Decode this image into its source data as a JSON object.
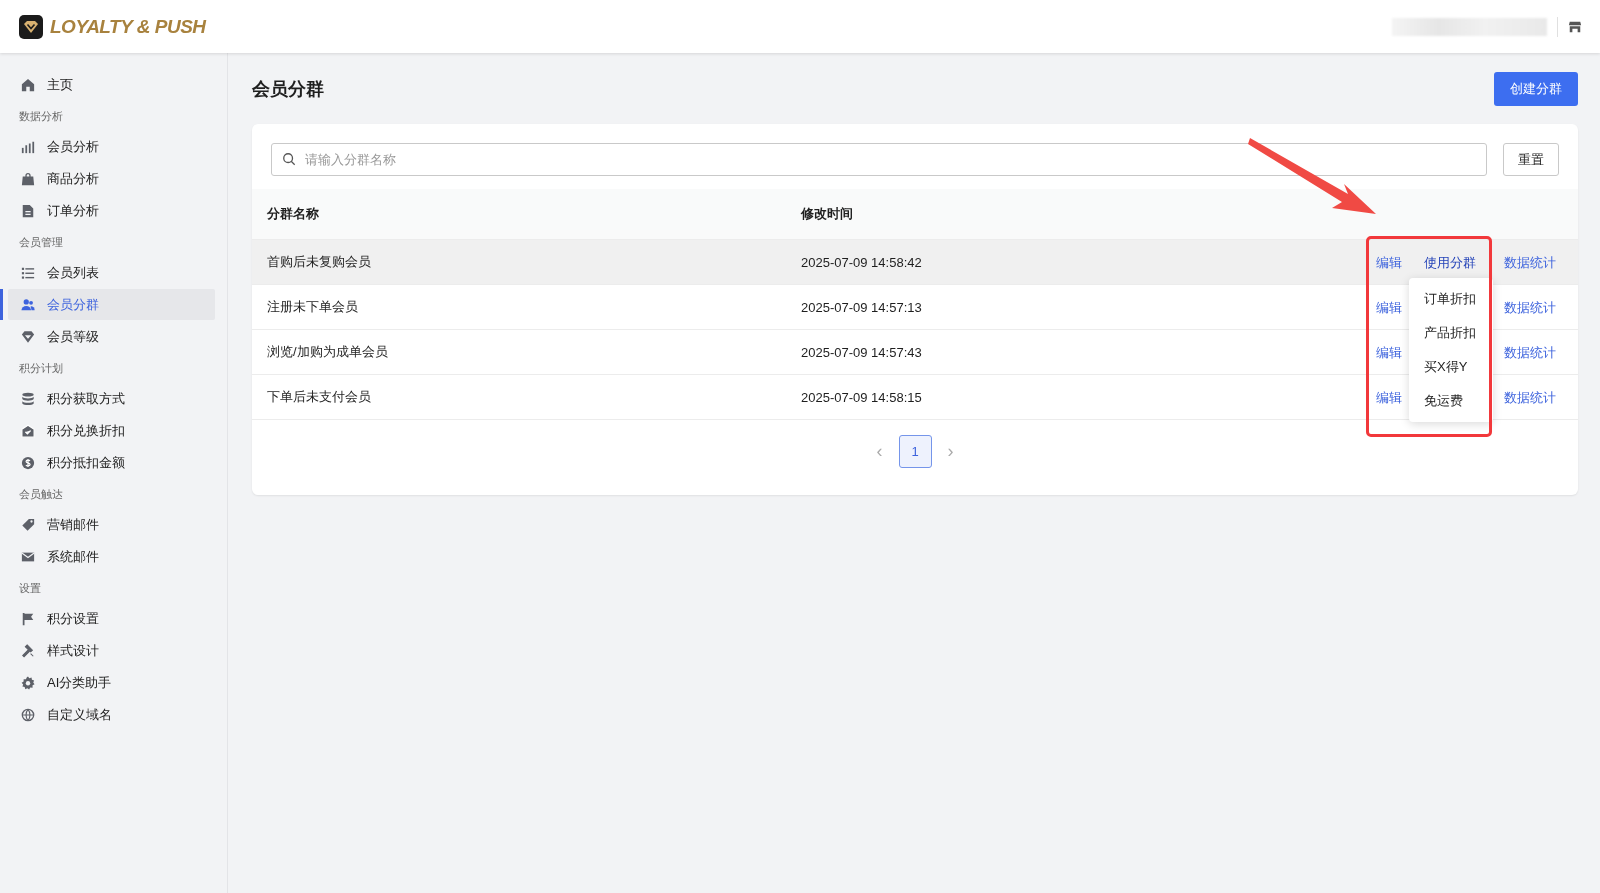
{
  "header": {
    "brand": "LOYALTY & PUSH"
  },
  "sidebar": {
    "sections": [
      {
        "items": [
          {
            "label": "主页",
            "selected": false
          }
        ]
      },
      {
        "label": "数据分析",
        "items": [
          {
            "label": "会员分析",
            "selected": false
          },
          {
            "label": "商品分析",
            "selected": false
          },
          {
            "label": "订单分析",
            "selected": false
          }
        ]
      },
      {
        "label": "会员管理",
        "items": [
          {
            "label": "会员列表",
            "selected": false
          },
          {
            "label": "会员分群",
            "selected": true
          },
          {
            "label": "会员等级",
            "selected": false
          }
        ]
      },
      {
        "label": "积分计划",
        "items": [
          {
            "label": "积分获取方式",
            "selected": false
          },
          {
            "label": "积分兑换折扣",
            "selected": false
          },
          {
            "label": "积分抵扣金额",
            "selected": false
          }
        ]
      },
      {
        "label": "会员触达",
        "items": [
          {
            "label": "营销邮件",
            "selected": false
          },
          {
            "label": "系统邮件",
            "selected": false
          }
        ]
      },
      {
        "label": "设置",
        "items": [
          {
            "label": "积分设置",
            "selected": false
          },
          {
            "label": "样式设计",
            "selected": false
          },
          {
            "label": "AI分类助手",
            "selected": false
          },
          {
            "label": "自定义域名",
            "selected": false
          }
        ]
      }
    ]
  },
  "page": {
    "title": "会员分群",
    "create_button": "创建分群"
  },
  "search": {
    "placeholder": "请输入分群名称",
    "reset_button": "重置"
  },
  "table": {
    "columns": [
      "分群名称",
      "修改时间"
    ],
    "rows": [
      {
        "name": "首购后未复购会员",
        "modified": "2025-07-09 14:58:42",
        "highlighted": true,
        "menu_open": true,
        "actions": [
          "编辑",
          "使用分群",
          "数据统计"
        ]
      },
      {
        "name": "注册未下单会员",
        "modified": "2025-07-09 14:57:13",
        "highlighted": false,
        "actions": [
          "编辑",
          "数据统计"
        ]
      },
      {
        "name": "浏览/加购为成单会员",
        "modified": "2025-07-09 14:57:43",
        "highlighted": false,
        "actions": [
          "编辑",
          "数据统计"
        ]
      },
      {
        "name": "下单后未支付会员",
        "modified": "2025-07-09 14:58:15",
        "highlighted": false,
        "actions": [
          "编辑",
          "数据统计"
        ]
      }
    ],
    "menu_items": [
      "订单折扣",
      "产品折扣",
      "买X得Y",
      "免运费"
    ]
  },
  "pagination": {
    "prev": "‹",
    "pages": [
      {
        "label": "1",
        "selected": true
      }
    ],
    "next": "›"
  }
}
